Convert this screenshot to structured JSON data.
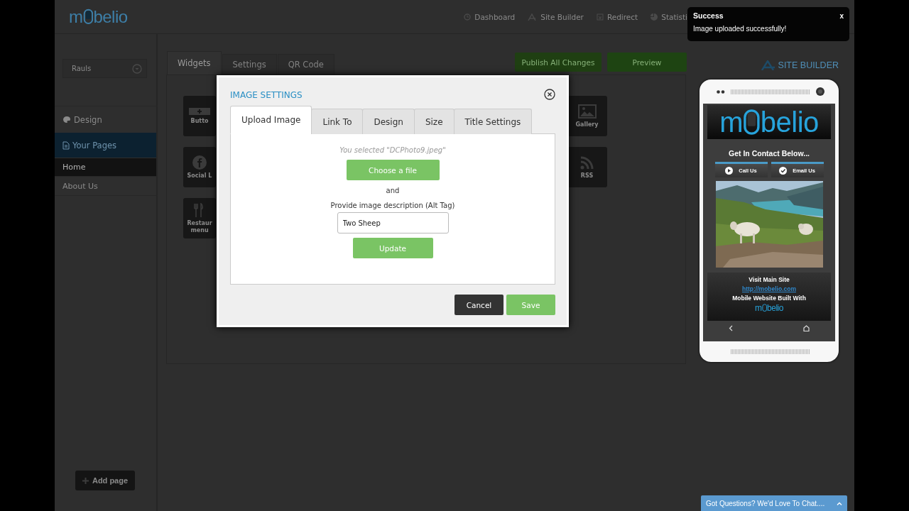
{
  "header": {
    "logo": [
      "m",
      "belio"
    ],
    "nav": [
      {
        "label": "Dashboard",
        "kind": "dashboard"
      },
      {
        "label": "Site Builder",
        "kind": "builder"
      },
      {
        "label": "Redirect",
        "kind": "redirect"
      },
      {
        "label": "Statisti",
        "kind": "stats"
      }
    ]
  },
  "sidebar": {
    "site_select": "Rauls",
    "menu": [
      {
        "label": "Design",
        "kind": "design",
        "selected": false
      },
      {
        "label": "Your Pages",
        "kind": "pages",
        "selected": true
      }
    ],
    "pages": [
      {
        "label": "Home",
        "selected": true
      },
      {
        "label": "About Us",
        "selected": false
      }
    ],
    "add_button": "Add page"
  },
  "editor": {
    "tabs": [
      {
        "label": "Widgets",
        "selected": true
      },
      {
        "label": "Settings",
        "selected": false
      },
      {
        "label": "QR Code",
        "selected": false
      }
    ],
    "actions": [
      "Publish All Changes",
      "Preview"
    ],
    "widgets_left": [
      {
        "label": "Butto",
        "kind": "button"
      },
      {
        "label": "Social L",
        "kind": "social"
      },
      {
        "label": "Restaur menu",
        "kind": "restaurant"
      }
    ],
    "widgets_right": [
      {
        "label": "Gallery",
        "kind": "gallery"
      },
      {
        "label": "RSS",
        "kind": "rss"
      }
    ]
  },
  "site_builder": {
    "label": "SITE BUILDER"
  },
  "phone": {
    "logo": [
      "m",
      "belio"
    ],
    "heading": "Get In Contact Below...",
    "buttons": [
      {
        "label": "Call Us",
        "kind": "call"
      },
      {
        "label": "Email Us",
        "kind": "email"
      }
    ],
    "image": {
      "kind": "picture"
    },
    "visit": "Visit Main Site",
    "link": "http://mobelio.com",
    "built_with": "Mobile Website Built With",
    "footer_logo": [
      "m",
      "belio"
    ]
  },
  "dialog": {
    "title": "IMAGE SETTINGS",
    "tabs": [
      {
        "label": "Upload Image",
        "selected": true
      },
      {
        "label": "Link To",
        "selected": false
      },
      {
        "label": "Design",
        "selected": false
      },
      {
        "label": "Size",
        "selected": false
      },
      {
        "label": "Title Settings",
        "selected": false
      }
    ],
    "selected_file": "You selected \"DCPhoto9.jpeg\"",
    "choose_button": "Choose a file",
    "and": "and",
    "alt_label": "Provide image description (Alt Tag)",
    "alt_value": "Two Sheep",
    "update_button": "Update",
    "cancel_button": "Cancel",
    "save_button": "Save"
  },
  "toast": {
    "title": "Success",
    "close": "x",
    "message": "Image uploaded successfully!"
  },
  "chat": {
    "label": "Got Questions? We'd Love To Chat...."
  }
}
